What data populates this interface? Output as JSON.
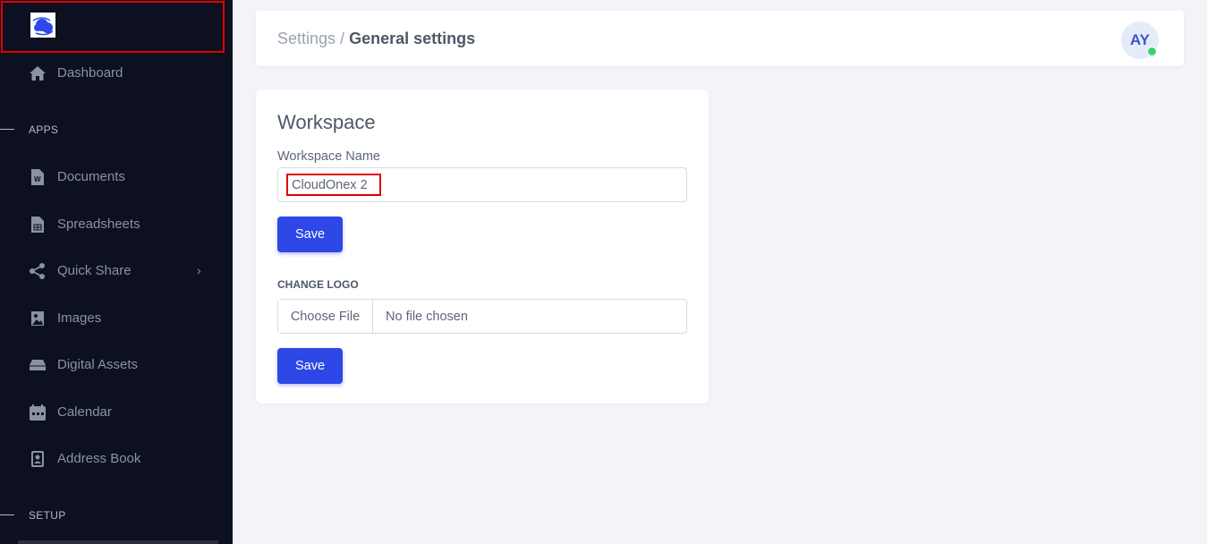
{
  "sidebar": {
    "logo_icon": "cloud-logo-icon",
    "items": [
      {
        "label": "Dashboard",
        "icon": "home-icon"
      },
      {
        "label": "Documents",
        "icon": "word-document-icon"
      },
      {
        "label": "Spreadsheets",
        "icon": "spreadsheet-icon"
      },
      {
        "label": "Quick Share",
        "icon": "share-icon",
        "chevron": "›"
      },
      {
        "label": "Images",
        "icon": "image-icon"
      },
      {
        "label": "Digital Assets",
        "icon": "drive-icon"
      },
      {
        "label": "Calendar",
        "icon": "calendar-icon"
      },
      {
        "label": "Address Book",
        "icon": "address-book-icon"
      }
    ],
    "sections": {
      "apps": "APPS",
      "setup": "SETUP"
    }
  },
  "header": {
    "breadcrumb_parent": "Settings",
    "breadcrumb_separator": " / ",
    "breadcrumb_current": "General settings",
    "avatar_initials": "AY"
  },
  "workspace": {
    "title": "Workspace",
    "name_label": "Workspace Name",
    "name_value": "CloudOnex 2",
    "save_label": "Save",
    "change_logo_title": "CHANGE LOGO",
    "choose_file_label": "Choose File",
    "file_status": "No file chosen",
    "save_logo_label": "Save"
  },
  "colors": {
    "sidebar_bg": "#0c1020",
    "accent": "#2d48e6",
    "highlight_border": "#e10000",
    "online_status": "#3dd16f"
  }
}
